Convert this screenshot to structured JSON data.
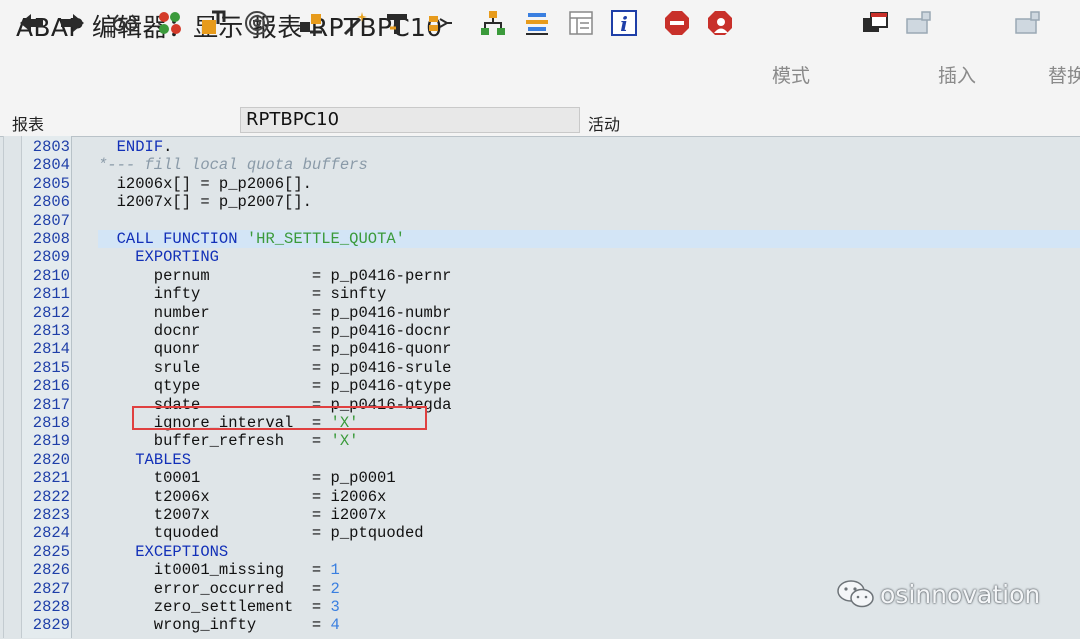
{
  "window": {
    "title": "ABAP 编辑器：显示 报表 RPTBPC10"
  },
  "toolbar": {
    "icons": [
      "back-icon",
      "forward-icon",
      "glasses-icon",
      "activate-icon",
      "transport-icon",
      "spiral-icon",
      "object-list-icon",
      "wand-icon",
      "stamp-icon",
      "structure-icon",
      "hierarchy-icon",
      "stack-icon",
      "document-icon",
      "info-icon",
      "stop-icon",
      "user-stop-icon",
      "window-icon",
      "insert-icon",
      "replace-icon"
    ],
    "mode_label": "模式",
    "insert_label": "插入",
    "replace_label": "替换"
  },
  "fields": {
    "report_label": "报表",
    "report_value": "RPTBPC10",
    "status": "活动"
  },
  "colors": {
    "keyword": "#1230b8",
    "comment": "#8a9aa8",
    "string": "#3a9a3a",
    "number": "#3a7fe0",
    "highlight_box": "#e04040"
  },
  "code": {
    "lines": [
      {
        "no": "2803",
        "parts": [
          [
            "",
            "  "
          ],
          [
            "kw",
            "ENDIF"
          ],
          [
            "",
            "."
          ]
        ]
      },
      {
        "no": "2804",
        "parts": [
          [
            "cm",
            "*--- fill local quota buffers"
          ]
        ]
      },
      {
        "no": "2805",
        "parts": [
          [
            "",
            "  i2006x[] = p_p2006[]."
          ]
        ]
      },
      {
        "no": "2806",
        "parts": [
          [
            "",
            "  i2007x[] = p_p2007[]."
          ]
        ]
      },
      {
        "no": "2807",
        "parts": []
      },
      {
        "no": "2808",
        "parts": [
          [
            "",
            "  "
          ],
          [
            "kw",
            "CALL FUNCTION "
          ],
          [
            "st",
            "'HR_SETTLE_QUOTA'"
          ]
        ],
        "hl": true
      },
      {
        "no": "2809",
        "parts": [
          [
            "",
            "    "
          ],
          [
            "kw",
            "EXPORTING"
          ]
        ]
      },
      {
        "no": "2810",
        "parts": [
          [
            "",
            "      pernum           = p_p0416-pernr"
          ]
        ]
      },
      {
        "no": "2811",
        "parts": [
          [
            "",
            "      infty            = sinfty"
          ]
        ]
      },
      {
        "no": "2812",
        "parts": [
          [
            "",
            "      number           = p_p0416-numbr"
          ]
        ]
      },
      {
        "no": "2813",
        "parts": [
          [
            "",
            "      docnr            = p_p0416-docnr"
          ]
        ]
      },
      {
        "no": "2814",
        "parts": [
          [
            "",
            "      quonr            = p_p0416-quonr"
          ]
        ]
      },
      {
        "no": "2815",
        "parts": [
          [
            "",
            "      srule            = p_p0416-srule"
          ]
        ]
      },
      {
        "no": "2816",
        "parts": [
          [
            "",
            "      qtype            = p_p0416-qtype"
          ]
        ]
      },
      {
        "no": "2817",
        "parts": [
          [
            "",
            "      sdate            = p_p0416-begda"
          ]
        ]
      },
      {
        "no": "2818",
        "parts": [
          [
            "",
            "      ignore_interval  = "
          ],
          [
            "st",
            "'X'"
          ]
        ]
      },
      {
        "no": "2819",
        "parts": [
          [
            "",
            "      buffer_refresh   = "
          ],
          [
            "st",
            "'X'"
          ]
        ]
      },
      {
        "no": "2820",
        "parts": [
          [
            "",
            "    "
          ],
          [
            "kw",
            "TABLES"
          ]
        ]
      },
      {
        "no": "2821",
        "parts": [
          [
            "",
            "      t0001            = p_p0001"
          ]
        ]
      },
      {
        "no": "2822",
        "parts": [
          [
            "",
            "      t2006x           = i2006x"
          ]
        ]
      },
      {
        "no": "2823",
        "parts": [
          [
            "",
            "      t2007x           = i2007x"
          ]
        ]
      },
      {
        "no": "2824",
        "parts": [
          [
            "",
            "      tquoded          = p_ptquoded"
          ]
        ]
      },
      {
        "no": "2825",
        "parts": [
          [
            "",
            "    "
          ],
          [
            "kw",
            "EXCEPTIONS"
          ]
        ]
      },
      {
        "no": "2826",
        "parts": [
          [
            "",
            "      it0001_missing   = "
          ],
          [
            "nm",
            "1"
          ]
        ]
      },
      {
        "no": "2827",
        "parts": [
          [
            "",
            "      error_occurred   = "
          ],
          [
            "nm",
            "2"
          ]
        ]
      },
      {
        "no": "2828",
        "parts": [
          [
            "",
            "      zero_settlement  = "
          ],
          [
            "nm",
            "3"
          ]
        ]
      },
      {
        "no": "2829",
        "parts": [
          [
            "",
            "      wrong_infty      = "
          ],
          [
            "nm",
            "4"
          ]
        ]
      }
    ]
  },
  "watermark": {
    "text": "osinnovation"
  }
}
